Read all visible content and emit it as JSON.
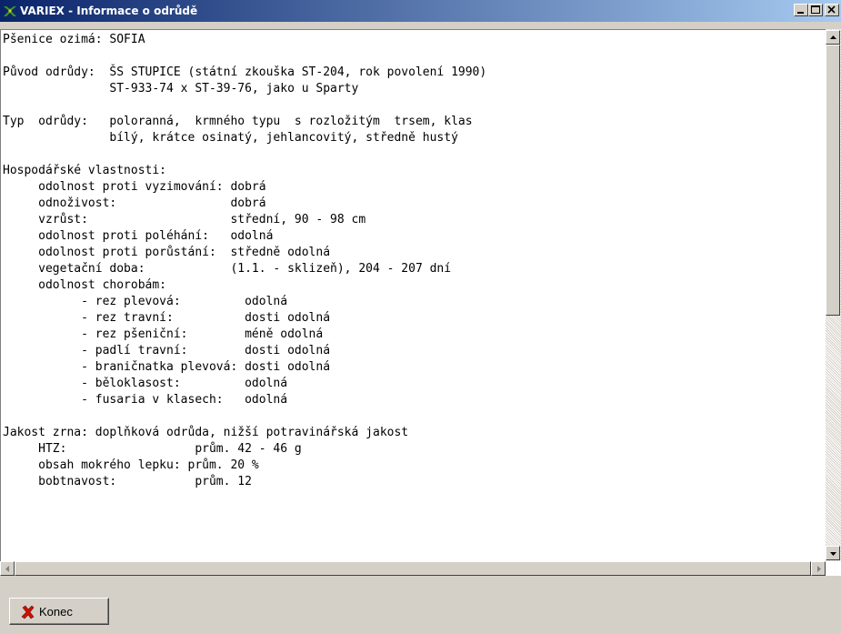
{
  "window": {
    "title": "VARIEX - Informace o odrůdě",
    "caption_buttons": [
      "minimize",
      "maximize",
      "close"
    ]
  },
  "variety_info": {
    "lines": [
      "Pšenice ozimá: SOFIA",
      "",
      "Původ odrůdy:  ŠS STUPICE (státní zkouška ST-204, rok povolení 1990)",
      "               ST-933-74 x ST-39-76, jako u Sparty",
      "",
      "Typ  odrůdy:   poloranná,  krmného typu  s rozložitým  trsem, klas",
      "               bílý, krátce osinatý, jehlancovitý, středně hustý",
      "",
      "Hospodářské vlastnosti:",
      "     odolnost proti vyzimování: dobrá",
      "     odnoživost:                dobrá",
      "     vzrůst:                    střední, 90 - 98 cm",
      "     odolnost proti poléhání:   odolná",
      "     odolnost proti porůstání:  středně odolná",
      "     vegetační doba:            (1.1. - sklizeň), 204 - 207 dní",
      "     odolnost chorobám:",
      "           - rez plevová:         odolná",
      "           - rez travní:          dosti odolná",
      "           - rez pšeniční:        méně odolná",
      "           - padlí travní:        dosti odolná",
      "           - braničnatka plevová: dosti odolná",
      "           - běloklasost:         odolná",
      "           - fusaria v klasech:   odolná",
      "",
      "Jakost zrna: doplňková odrůda, nižší potravinářská jakost",
      "     HTZ:                  prům. 42 - 46 g",
      "     obsah mokrého lepku: prům. 20 %",
      "     bobtnavost:           prům. 12"
    ]
  },
  "buttons": {
    "close_label": "Konec"
  },
  "icons": {
    "app": "variex-app-icon",
    "close_action": "red-x-icon"
  },
  "colors": {
    "titlebar_start": "#0a246a",
    "titlebar_end": "#a6caf0",
    "face": "#d4d0c8",
    "close_x": "#cc1100"
  }
}
